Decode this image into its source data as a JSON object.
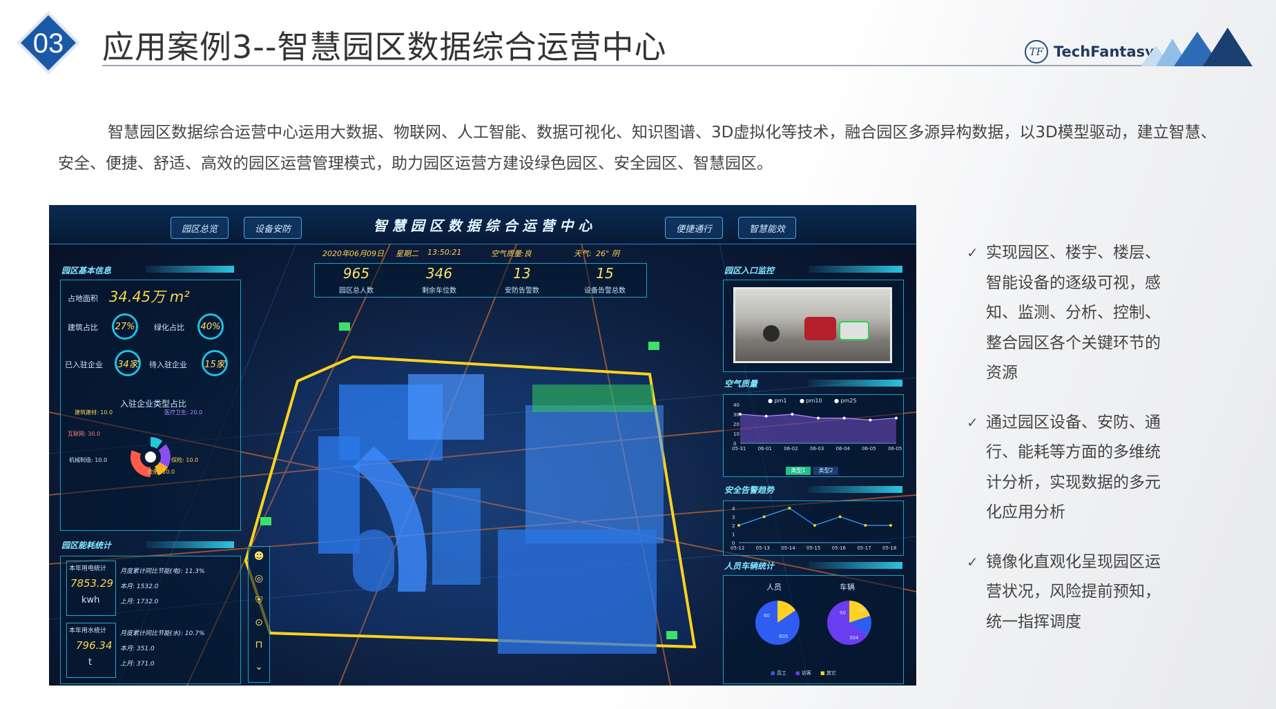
{
  "header": {
    "badge_number": "03",
    "title": "应用案例3--智慧园区数据综合运营中心",
    "brand": "TechFantasy",
    "brand_logo": "TF"
  },
  "intro": "智慧园区数据综合运营中心运用大数据、物联网、人工智能、数据可视化、知识图谱、3D虚拟化等技术，融合园区多源异构数据，以3D模型驱动，建立智慧、安全、便捷、舒适、高效的园区运营管理模式，助力园区运营方建设绿色园区、安全园区、智慧园区。",
  "dashboard": {
    "title": "智 慧 园 区 数 据 综 合 运 营 中 心",
    "nav_left": [
      "园区总览",
      "设备安防"
    ],
    "nav_right": [
      "便捷通行",
      "智慧能效"
    ],
    "date": "2020年06月09日",
    "weekday": "星期二",
    "time": "13:50:21",
    "air": "空气质量:良",
    "weather": "天气:",
    "weather_value": "26° 阴",
    "stats": [
      {
        "value": "965",
        "label": "园区总人数"
      },
      {
        "value": "346",
        "label": "剩余车位数"
      },
      {
        "value": "13",
        "label": "安防告警数"
      },
      {
        "value": "15",
        "label": "设备告警总数"
      }
    ],
    "basic": {
      "title": "园区基本信息",
      "area_label": "占地面积",
      "area_value": "34.45万 m²",
      "build_label": "建筑占比",
      "build_value": "27%",
      "green_label": "绿化占比",
      "green_value": "40%",
      "in_label": "已入驻企业",
      "in_value": "34家",
      "wait_label": "待入驻企业",
      "wait_value": "15家",
      "chart_title": "入驻企业类型占比",
      "slices": [
        "建筑建材: 10.0",
        "医疗卫生: 20.0",
        "互联网: 30.0",
        "机械制造: 10.0",
        "保险: 10.0",
        "金融: 10.0"
      ]
    },
    "energy": {
      "title": "园区能耗统计",
      "elec_label": "本年用电统计",
      "elec_value": "7853.29",
      "elec_unit": "kwh",
      "elec_line1": "月度累计同比节能(电): 11.3%",
      "elec_line2": "本月: 1532.0",
      "elec_line3": "上月: 1732.0",
      "water_label": "本年用水统计",
      "water_value": "796.34",
      "water_unit": "t",
      "water_line1": "月度累计同比节能(水): 10.7%",
      "water_line2": "本月: 351.0",
      "water_line3": "上月: 371.0"
    },
    "gate": {
      "title": "园区入口监控"
    },
    "air_quality": {
      "title": "空气质量",
      "legend": [
        "pm1",
        "pm10",
        "pm25"
      ],
      "x": [
        "05-31",
        "06-01",
        "06-02",
        "06-03",
        "06-04",
        "06-05",
        "06-05"
      ],
      "yticks": [
        "40",
        "30",
        "20",
        "10",
        "0"
      ],
      "values": [
        30,
        28,
        30,
        26,
        26,
        24,
        26
      ],
      "types": [
        "类型1",
        "类型2"
      ]
    },
    "security": {
      "title": "安全告警趋势",
      "x": [
        "05-12",
        "05-13",
        "05-14",
        "05-15",
        "05-16",
        "05-17",
        "05-18"
      ],
      "yticks": [
        "4",
        "3",
        "2",
        "1",
        "0"
      ],
      "values": [
        2,
        3,
        4,
        2,
        3,
        2,
        2
      ]
    },
    "people_car": {
      "title": "人员车辆统计",
      "people_label": "人员",
      "car_label": "车辆",
      "people_values": [
        "60",
        "805"
      ],
      "car_values": [
        "90",
        "40",
        "304"
      ],
      "legend": [
        "员工",
        "访客",
        "其它"
      ]
    }
  },
  "bullets": [
    "实现园区、楼宇、楼层、智能设备的逐级可视，感知、监测、分析、控制、整合园区各个关键环节的资源",
    "通过园区设备、安防、通行、能耗等方面的多维统计分析，实现数据的多元化应用分析",
    "镜像化直观化呈现园区运营状况，风险提前预知，统一指挥调度"
  ],
  "colors": {
    "accent": "#1e5ea8",
    "panel_border": "#1aa3c6",
    "highlight": "#ffe066"
  }
}
